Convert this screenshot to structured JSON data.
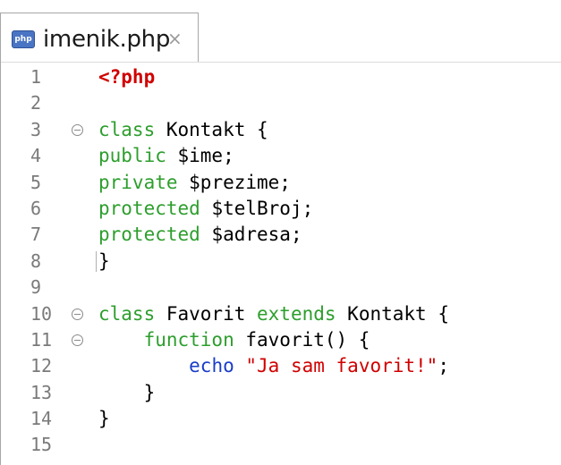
{
  "tab": {
    "icon": "php-file-icon",
    "title": "imenik.php",
    "close": "×"
  },
  "colors": {
    "keyword": "#2d9e2d",
    "string": "#d00000",
    "php_tag": "#d00000",
    "echo": "#1a3cc8",
    "line_number": "#7a7a7a"
  },
  "code_lines": [
    {
      "num": "1",
      "fold": false,
      "tokens": [
        {
          "t": "tag",
          "v": "<?php"
        }
      ]
    },
    {
      "num": "2",
      "fold": false,
      "tokens": []
    },
    {
      "num": "3",
      "fold": true,
      "tokens": [
        {
          "t": "kw",
          "v": "class"
        },
        {
          "t": "plain",
          "v": " Kontakt {"
        }
      ]
    },
    {
      "num": "4",
      "fold": false,
      "tokens": [
        {
          "t": "kw",
          "v": "public"
        },
        {
          "t": "plain",
          "v": " $ime;"
        }
      ]
    },
    {
      "num": "5",
      "fold": false,
      "tokens": [
        {
          "t": "kw",
          "v": "private"
        },
        {
          "t": "plain",
          "v": " $prezime;"
        }
      ]
    },
    {
      "num": "6",
      "fold": false,
      "tokens": [
        {
          "t": "kw",
          "v": "protected"
        },
        {
          "t": "plain",
          "v": " $telBroj;"
        }
      ]
    },
    {
      "num": "7",
      "fold": false,
      "tokens": [
        {
          "t": "kw",
          "v": "protected"
        },
        {
          "t": "plain",
          "v": " $adresa;"
        }
      ]
    },
    {
      "num": "8",
      "fold": false,
      "tokens": [
        {
          "t": "plain",
          "v": "}"
        }
      ]
    },
    {
      "num": "9",
      "fold": false,
      "tokens": []
    },
    {
      "num": "10",
      "fold": true,
      "tokens": [
        {
          "t": "kw",
          "v": "class"
        },
        {
          "t": "plain",
          "v": " Favorit "
        },
        {
          "t": "kw",
          "v": "extends"
        },
        {
          "t": "plain",
          "v": " Kontakt {"
        }
      ]
    },
    {
      "num": "11",
      "fold": true,
      "tokens": [
        {
          "t": "plain",
          "v": "    "
        },
        {
          "t": "kw",
          "v": "function"
        },
        {
          "t": "plain",
          "v": " favorit() {"
        }
      ]
    },
    {
      "num": "12",
      "fold": false,
      "tokens": [
        {
          "t": "plain",
          "v": "        "
        },
        {
          "t": "echo",
          "v": "echo"
        },
        {
          "t": "plain",
          "v": " "
        },
        {
          "t": "str",
          "v": "\"Ja sam favorit!\""
        },
        {
          "t": "plain",
          "v": ";"
        }
      ]
    },
    {
      "num": "13",
      "fold": false,
      "tokens": [
        {
          "t": "plain",
          "v": "    }"
        }
      ]
    },
    {
      "num": "14",
      "fold": false,
      "tokens": [
        {
          "t": "plain",
          "v": "}"
        }
      ]
    },
    {
      "num": "15",
      "fold": false,
      "tokens": []
    }
  ]
}
